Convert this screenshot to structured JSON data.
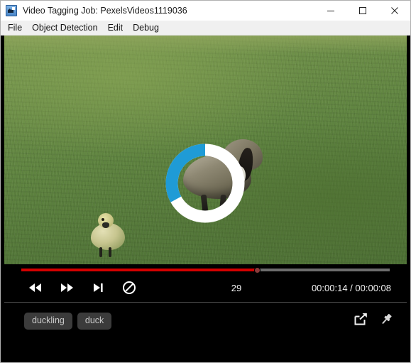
{
  "window": {
    "title": "Video Tagging Job: PexelsVideos1119036",
    "app_icon": "video-tag-app-icon",
    "controls": {
      "minimize": "minimize-icon",
      "maximize": "maximize-icon",
      "close": "close-icon"
    }
  },
  "menubar": {
    "items": [
      {
        "label": "File"
      },
      {
        "label": "Object Detection"
      },
      {
        "label": "Edit"
      },
      {
        "label": "Debug"
      }
    ]
  },
  "video": {
    "scene_description": "Canada goose and gosling walking on green grass",
    "overlay": {
      "type": "circular-progress",
      "progress_percent": 33,
      "arc_color": "#1f9bd6",
      "track_color": "#ffffff"
    }
  },
  "transport": {
    "seek": {
      "progress_percent": 64,
      "fill_color": "#d40000",
      "track_color": "#6d6d6d"
    },
    "buttons": [
      {
        "name": "rewind-button",
        "icon": "rewind-icon"
      },
      {
        "name": "fast-forward-button",
        "icon": "fast-forward-icon"
      },
      {
        "name": "step-forward-button",
        "icon": "step-forward-icon"
      },
      {
        "name": "no-detection-button",
        "icon": "prohibited-icon"
      }
    ],
    "frame_number": "29",
    "time_readout": "00:00:14 / 00:00:08"
  },
  "tags": {
    "chips": [
      {
        "label": "duckling"
      },
      {
        "label": "duck"
      }
    ],
    "actions": [
      {
        "name": "share-export-button",
        "icon": "share-icon"
      },
      {
        "name": "pin-button",
        "icon": "pin-icon"
      }
    ]
  },
  "colors": {
    "accent_blue": "#1f9bd6",
    "progress_red": "#d40000",
    "panel_black": "#000000",
    "chip_bg": "#3b3b3b",
    "chip_text": "#c9c9c9",
    "menubar_bg": "#f0f0f0"
  }
}
